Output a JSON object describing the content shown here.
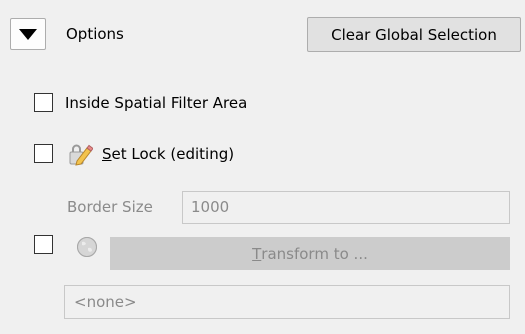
{
  "header": {
    "collapse_icon": "triangle-down-icon",
    "title": "Options",
    "clear_button_label": "Clear Global Selection"
  },
  "options": {
    "spatial_filter": {
      "label": "Inside Spatial Filter Area",
      "checked": false
    },
    "set_lock": {
      "label_mnemonic": "S",
      "label_rest": "et Lock (editing)",
      "icon": "pencil-lock-icon",
      "checked": false
    },
    "border_size": {
      "label": "Border Size",
      "value": "1000"
    },
    "transform": {
      "checked": false,
      "icon": "globe-icon",
      "button_mnemonic": "T",
      "button_rest": "ransform to ..."
    },
    "crs_value": "<none>"
  }
}
